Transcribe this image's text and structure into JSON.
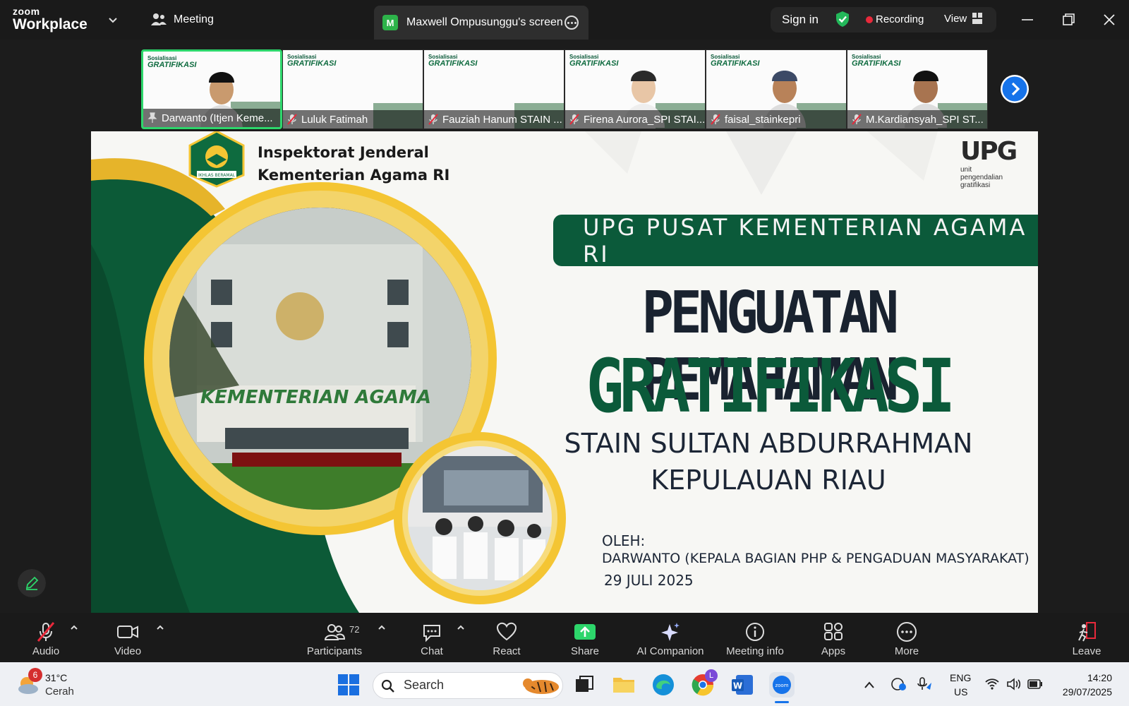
{
  "app": {
    "brand_top": "zoom",
    "brand_bottom": "Workplace"
  },
  "topbar": {
    "meeting_tab": "Meeting",
    "share_tab_initial": "M",
    "share_tab": "Maxwell Ompusunggu's screen",
    "sign_in": "Sign in",
    "recording": "Recording",
    "view": "View"
  },
  "thumbnails": [
    {
      "name": "Darwanto (Itjen Keme...",
      "active": true,
      "muted": false
    },
    {
      "name": "Luluk Fatimah",
      "active": false,
      "muted": true
    },
    {
      "name": "Fauziah Hanum STAIN ...",
      "active": false,
      "muted": true
    },
    {
      "name": "Firena Aurora_SPI STAI...",
      "active": false,
      "muted": true
    },
    {
      "name": "faisal_stainkepri",
      "active": false,
      "muted": true
    },
    {
      "name": "M.Kardiansyah_SPI ST...",
      "active": false,
      "muted": true
    }
  ],
  "thumb_title_small": "Sosialisasi",
  "thumb_title_big": "GRATIFIKASI",
  "slide": {
    "org_line1": "Inspektorat Jenderal",
    "org_line2": "Kementerian Agama RI",
    "upg_big": "UPG",
    "upg_small1": "unit",
    "upg_small2": "pengendalian",
    "upg_small3": "gratifikasi",
    "banner": "UPG PUSAT KEMENTERIAN AGAMA RI",
    "title1": "PENGUATAN PEMAHAMAN",
    "title2": "GRATIFIKASI",
    "subtitle1": "STAIN SULTAN ABDURRAHMAN",
    "subtitle2": "KEPULAUAN RIAU",
    "by_label": "OLEH:",
    "by_name": "DARWANTO (KEPALA BAGIAN PHP & PENGADUAN MASYARAKAT)",
    "date": "29 JULI 2025",
    "building_sign": "KEMENTERIAN AGAMA",
    "emblem_text": "IKHLAS BERAMAL"
  },
  "toolbar": {
    "audio": "Audio",
    "video": "Video",
    "participants": "Participants",
    "participants_count": "72",
    "chat": "Chat",
    "react": "React",
    "share": "Share",
    "ai": "AI Companion",
    "info": "Meeting info",
    "apps": "Apps",
    "more": "More",
    "leave": "Leave"
  },
  "taskbar": {
    "weather_badge": "6",
    "temp": "31°C",
    "condition": "Cerah",
    "search": "Search",
    "chrome_badge": "L",
    "lang1": "ENG",
    "lang2": "US",
    "time": "14:20",
    "date": "29/07/2025"
  },
  "colors": {
    "accent_green": "#0b5a3a",
    "gold": "#f2c230",
    "zoom_blue": "#1673ea",
    "record_red": "#e8293b"
  }
}
